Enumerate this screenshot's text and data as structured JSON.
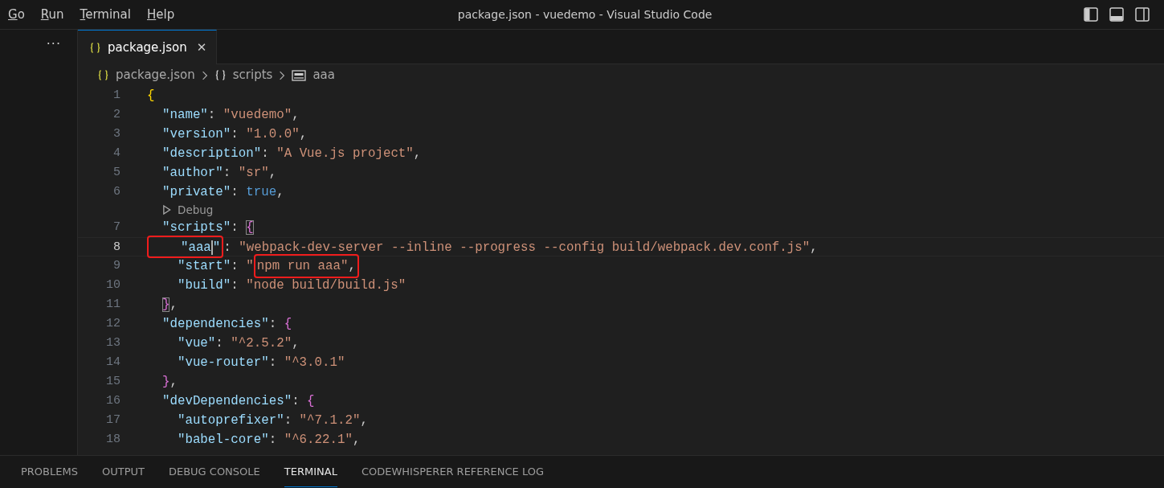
{
  "menu": [
    {
      "label": "Go"
    },
    {
      "label": "Run"
    },
    {
      "label": "Terminal"
    },
    {
      "label": "Help"
    }
  ],
  "window": {
    "title": "package.json - vuedemo - Visual Studio Code"
  },
  "sidebar": {
    "more": "···"
  },
  "tabs": [
    {
      "label": "package.json",
      "selected": true,
      "close": "✕"
    }
  ],
  "breadcrumb": [
    {
      "label": "package.json",
      "kind": "file"
    },
    {
      "label": "scripts",
      "kind": "object"
    },
    {
      "label": "aaa",
      "kind": "string"
    }
  ],
  "lines": [
    {
      "kind": "code",
      "number": "1",
      "current": false,
      "tokens": [
        {
          "text": "{",
          "kind": "brace1"
        }
      ]
    },
    {
      "kind": "code",
      "number": "2",
      "current": false,
      "tokens": [
        {
          "text": "  \"name\"",
          "kind": "key"
        },
        {
          "text": ": ",
          "kind": "punct"
        },
        {
          "text": "\"vuedemo\"",
          "kind": "string"
        },
        {
          "text": ",",
          "kind": "punct"
        }
      ]
    },
    {
      "kind": "code",
      "number": "3",
      "current": false,
      "tokens": [
        {
          "text": "  \"version\"",
          "kind": "key"
        },
        {
          "text": ": ",
          "kind": "punct"
        },
        {
          "text": "\"1.0.0\"",
          "kind": "string"
        },
        {
          "text": ",",
          "kind": "punct"
        }
      ]
    },
    {
      "kind": "code",
      "number": "4",
      "current": false,
      "tokens": [
        {
          "text": "  \"description\"",
          "kind": "key"
        },
        {
          "text": ": ",
          "kind": "punct"
        },
        {
          "text": "\"A Vue.js project\"",
          "kind": "string"
        },
        {
          "text": ",",
          "kind": "punct"
        }
      ]
    },
    {
      "kind": "code",
      "number": "5",
      "current": false,
      "tokens": [
        {
          "text": "  \"author\"",
          "kind": "key"
        },
        {
          "text": ": ",
          "kind": "punct"
        },
        {
          "text": "\"sr\"",
          "kind": "string"
        },
        {
          "text": ",",
          "kind": "punct"
        }
      ]
    },
    {
      "kind": "code",
      "number": "6",
      "current": false,
      "tokens": [
        {
          "text": "  \"private\"",
          "kind": "key"
        },
        {
          "text": ": ",
          "kind": "punct"
        },
        {
          "text": "true",
          "kind": "bool"
        },
        {
          "text": ",",
          "kind": "punct"
        }
      ]
    },
    {
      "kind": "codelens",
      "label": "Debug"
    },
    {
      "kind": "code",
      "number": "7",
      "current": false,
      "tokens": [
        {
          "text": "  \"scripts\"",
          "kind": "key"
        },
        {
          "text": ": ",
          "kind": "punct"
        },
        {
          "text": "{",
          "kind": "brace2",
          "matched": true
        }
      ]
    },
    {
      "kind": "code",
      "number": "8",
      "current": true,
      "tokens": [
        {
          "text": "    \"aaa",
          "kind": "key",
          "boxed": true,
          "caret": true
        },
        {
          "text": "\"",
          "kind": "key",
          "boxed": true
        },
        {
          "text": ": ",
          "kind": "punct"
        },
        {
          "text": "\"webpack-dev-server --inline --progress --config build/webpack.dev.conf.js\"",
          "kind": "string"
        },
        {
          "text": ",",
          "kind": "punct"
        }
      ]
    },
    {
      "kind": "code",
      "number": "9",
      "current": false,
      "tokens": [
        {
          "text": "    \"start\"",
          "kind": "key"
        },
        {
          "text": ": ",
          "kind": "punct"
        },
        {
          "text": "\"",
          "kind": "string"
        },
        {
          "text": "npm run aaa\"",
          "kind": "string",
          "boxed": true
        },
        {
          "text": ",",
          "kind": "punct",
          "boxed": true
        }
      ]
    },
    {
      "kind": "code",
      "number": "10",
      "current": false,
      "tokens": [
        {
          "text": "    \"build\"",
          "kind": "key"
        },
        {
          "text": ": ",
          "kind": "punct"
        },
        {
          "text": "\"node build/build.js\"",
          "kind": "string"
        }
      ]
    },
    {
      "kind": "code",
      "number": "11",
      "current": false,
      "tokens": [
        {
          "text": "  }",
          "kind": "brace2",
          "matched": true
        },
        {
          "text": ",",
          "kind": "punct"
        }
      ]
    },
    {
      "kind": "code",
      "number": "12",
      "current": false,
      "tokens": [
        {
          "text": "  \"dependencies\"",
          "kind": "key"
        },
        {
          "text": ": ",
          "kind": "punct"
        },
        {
          "text": "{",
          "kind": "brace2"
        }
      ]
    },
    {
      "kind": "code",
      "number": "13",
      "current": false,
      "tokens": [
        {
          "text": "    \"vue\"",
          "kind": "key"
        },
        {
          "text": ": ",
          "kind": "punct"
        },
        {
          "text": "\"^2.5.2\"",
          "kind": "string"
        },
        {
          "text": ",",
          "kind": "punct"
        }
      ]
    },
    {
      "kind": "code",
      "number": "14",
      "current": false,
      "tokens": [
        {
          "text": "    \"vue-router\"",
          "kind": "key"
        },
        {
          "text": ": ",
          "kind": "punct"
        },
        {
          "text": "\"^3.0.1\"",
          "kind": "string"
        }
      ]
    },
    {
      "kind": "code",
      "number": "15",
      "current": false,
      "tokens": [
        {
          "text": "  }",
          "kind": "brace2"
        },
        {
          "text": ",",
          "kind": "punct"
        }
      ]
    },
    {
      "kind": "code",
      "number": "16",
      "current": false,
      "tokens": [
        {
          "text": "  \"devDependencies\"",
          "kind": "key"
        },
        {
          "text": ": ",
          "kind": "punct"
        },
        {
          "text": "{",
          "kind": "brace2"
        }
      ]
    },
    {
      "kind": "code",
      "number": "17",
      "current": false,
      "tokens": [
        {
          "text": "    \"autoprefixer\"",
          "kind": "key"
        },
        {
          "text": ": ",
          "kind": "punct"
        },
        {
          "text": "\"^7.1.2\"",
          "kind": "string"
        },
        {
          "text": ",",
          "kind": "punct"
        }
      ]
    },
    {
      "kind": "code",
      "number": "18",
      "current": false,
      "tokens": [
        {
          "text": "    \"babel-core\"",
          "kind": "key"
        },
        {
          "text": ": ",
          "kind": "punct"
        },
        {
          "text": "\"^6.22.1\"",
          "kind": "string"
        },
        {
          "text": ",",
          "kind": "punct"
        }
      ]
    }
  ],
  "panel_tabs": [
    {
      "label": "PROBLEMS",
      "selected": false
    },
    {
      "label": "OUTPUT",
      "selected": false
    },
    {
      "label": "DEBUG CONSOLE",
      "selected": false
    },
    {
      "label": "TERMINAL",
      "selected": true
    },
    {
      "label": "CODEWHISPERER REFERENCE LOG",
      "selected": false
    }
  ]
}
